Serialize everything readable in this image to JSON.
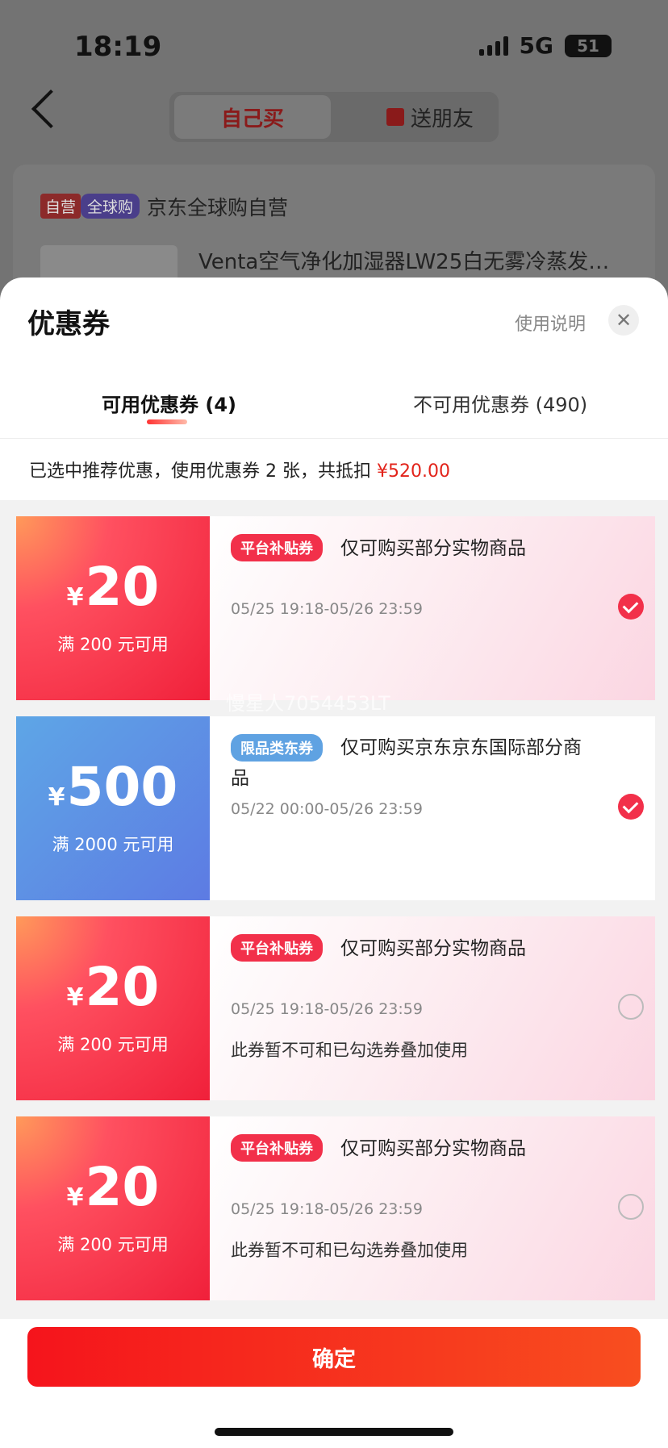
{
  "status": {
    "time": "18:19",
    "network": "5G",
    "battery": "51"
  },
  "top_tabs": {
    "self": "自己买",
    "friend": "送朋友"
  },
  "store": {
    "tag_self": "自营",
    "tag_global": "全球购",
    "name": "京东全球购自营"
  },
  "product": {
    "name": "Venta空气净化加湿器LW25白无雾冷蒸发式…"
  },
  "sheet": {
    "title": "优惠券",
    "help": "使用说明",
    "close": "✕",
    "tab_available": "可用优惠券 (4)",
    "tab_unavailable": "不可用优惠券 (490)",
    "summary_text": "已选中推荐优惠，使用优惠券 2 张，共抵扣 ",
    "summary_amount": "¥520.00"
  },
  "coupons": [
    {
      "yen": "¥",
      "amount": "20",
      "condition": "满 200 元可用",
      "badge": "平台补贴券",
      "desc": "仅可购买部分实物商品",
      "time": "05/25 19:18-05/26 23:59",
      "note": "",
      "selected": true
    },
    {
      "yen": "¥",
      "amount": "500",
      "condition": "满 2000 元可用",
      "badge": "限品类东券",
      "desc": "仅可购买京东京东国际部分商品",
      "time": "05/22 00:00-05/26 23:59",
      "note": "",
      "selected": true
    },
    {
      "yen": "¥",
      "amount": "20",
      "condition": "满 200 元可用",
      "badge": "平台补贴券",
      "desc": "仅可购买部分实物商品",
      "time": "05/25 19:18-05/26 23:59",
      "note": "此券暂不可和已勾选券叠加使用",
      "selected": false
    },
    {
      "yen": "¥",
      "amount": "20",
      "condition": "满 200 元可用",
      "badge": "平台补贴券",
      "desc": "仅可购买部分实物商品",
      "time": "05/25 19:18-05/26 23:59",
      "note": "此券暂不可和已勾选券叠加使用",
      "selected": false
    }
  ],
  "watermark": "慢星人7054453LT",
  "confirm": "确定",
  "colors": {
    "accent": "#f2304a",
    "confirm": "#f5141c",
    "blue_coupon": "#5d7be3"
  }
}
